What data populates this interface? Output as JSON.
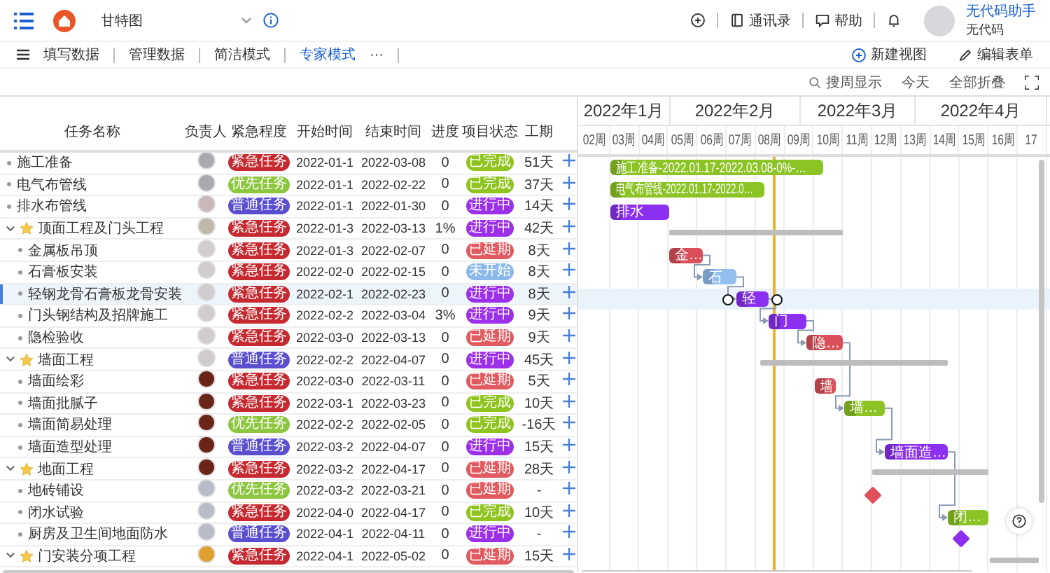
{
  "topbar": {
    "title": "甘特图",
    "actions": [
      {
        "kind": "contacts",
        "label": "通讯录"
      },
      {
        "kind": "help",
        "label": "帮助"
      }
    ],
    "user": {
      "name": "无代码助手",
      "org": "无代码"
    }
  },
  "view_tabs": [
    {
      "label": "填写数据",
      "selected": false
    },
    {
      "label": "管理数据",
      "selected": false
    },
    {
      "label": "简洁模式",
      "selected": false
    },
    {
      "label": "专家模式",
      "selected": true
    }
  ],
  "more": "···",
  "view_actions": [
    {
      "kind": "new",
      "label": "新建视图"
    },
    {
      "kind": "edit",
      "label": "编辑表单"
    }
  ],
  "toolbar": [
    {
      "kind": "search",
      "label": "搜周显示"
    },
    {
      "kind": "plain",
      "label": "今天"
    },
    {
      "kind": "plain",
      "label": "全部折叠"
    }
  ],
  "table": {
    "columns": [
      "任务名称",
      "负责人",
      "紧急程度",
      "开始时间",
      "结束时间",
      "进度",
      "项目状态",
      "工期"
    ],
    "rows": [
      {
        "name": "施工准备",
        "selected": false,
        "owner": {
          "color": "#a8aab0"
        },
        "urgency": {
          "label": "紧急任务",
          "color": "#c62a30"
        },
        "start": "2022-01-1",
        "end": "2022-03-08",
        "progress": "0",
        "status": {
          "label": "已完成",
          "color": "#8fc31f"
        },
        "duration": "51天",
        "bar": {
          "kind": "bar",
          "label": "施工准备-2022.01.17-2022.03.08-0%-…",
          "color": "#8cc425"
        }
      },
      {
        "name": "电气布管线",
        "selected": false,
        "owner": {
          "color": "#a8aab0"
        },
        "urgency": {
          "label": "优先任务",
          "color": "#8dc63f"
        },
        "start": "2022-01-1",
        "end": "2022-02-22",
        "progress": "0",
        "status": {
          "label": "已完成",
          "color": "#8fc31f"
        },
        "duration": "37天",
        "bar": {
          "kind": "bar",
          "label": "电气布管线-2022.01.17-2022.0…",
          "color": "#8cc425"
        }
      },
      {
        "name": "排水布管线",
        "selected": false,
        "owner": {
          "color": "#c8b8b8"
        },
        "urgency": {
          "label": "普通任务",
          "color": "#5a4fcf"
        },
        "start": "2022-01-1",
        "end": "2022-01-30",
        "progress": "0",
        "status": {
          "label": "进行中",
          "color": "#9b30e8"
        },
        "duration": "14天",
        "bar": {
          "kind": "bar",
          "label": "排水",
          "color": "#8b2ff0"
        }
      },
      {
        "name": "顶面工程及门头工程",
        "expanded": true,
        "selected": false,
        "owner": {
          "color": "#c0b8a8"
        },
        "urgency": {
          "label": "紧急任务",
          "color": "#c62a30"
        },
        "start": "2022-01-3",
        "end": "2022-03-13",
        "progress": "1%",
        "status": {
          "label": "进行中",
          "color": "#9b30e8"
        },
        "duration": "42天",
        "bar": {
          "kind": "summary"
        },
        "children": [
          {
            "name": "金属板吊顶",
            "selected": false,
            "owner": {
              "color": "#d0ccd0"
            },
            "urgency": {
              "label": "紧急任务",
              "color": "#c62a30"
            },
            "start": "2022-01-3",
            "end": "2022-02-07",
            "progress": "0",
            "status": {
              "label": "已延期",
              "color": "#e05a5f"
            },
            "duration": "8天",
            "bar": {
              "kind": "bar",
              "label": "金…",
              "color": "#d9505a"
            }
          },
          {
            "name": "石膏板安装",
            "selected": false,
            "owner": {
              "color": "#d0ccd0"
            },
            "urgency": {
              "label": "紧急任务",
              "color": "#c62a30"
            },
            "start": "2022-02-0",
            "end": "2022-02-15",
            "progress": "0",
            "status": {
              "label": "未开始",
              "color": "#8ab8ea"
            },
            "duration": "8天",
            "bar": {
              "kind": "bar",
              "label": "石",
              "color": "#92bfee"
            }
          },
          {
            "name": "轻钢龙骨石膏板龙骨安装",
            "selected": true,
            "owner": {
              "color": "#d0ccd0"
            },
            "urgency": {
              "label": "紧急任务",
              "color": "#c62a30"
            },
            "start": "2022-02-1",
            "end": "2022-02-23",
            "progress": "0",
            "status": {
              "label": "进行中",
              "color": "#9b30e8"
            },
            "duration": "8天",
            "bar": {
              "kind": "bar",
              "label": "轻",
              "color": "#8b2ff0"
            }
          },
          {
            "name": "门头钢结构及招牌施工",
            "selected": false,
            "owner": {
              "color": "#d0ccd0"
            },
            "urgency": {
              "label": "紧急任务",
              "color": "#c62a30"
            },
            "start": "2022-02-2",
            "end": "2022-03-04",
            "progress": "3%",
            "status": {
              "label": "进行中",
              "color": "#9b30e8"
            },
            "duration": "9天",
            "bar": {
              "kind": "bar",
              "label": "门",
              "color": "#8b2ff0"
            }
          },
          {
            "name": "隐检验收",
            "selected": false,
            "owner": {
              "color": "#d0ccd0"
            },
            "urgency": {
              "label": "紧急任务",
              "color": "#c62a30"
            },
            "start": "2022-03-0",
            "end": "2022-03-13",
            "progress": "0",
            "status": {
              "label": "已延期",
              "color": "#e05a5f"
            },
            "duration": "9天",
            "bar": {
              "kind": "bar",
              "label": "隐…",
              "color": "#d9505a"
            }
          }
        ]
      },
      {
        "name": "墙面工程",
        "expanded": true,
        "selected": false,
        "owner": {
          "color": "#d0ccd0"
        },
        "urgency": {
          "label": "普通任务",
          "color": "#5a4fcf"
        },
        "start": "2022-02-2",
        "end": "2022-04-07",
        "progress": "0",
        "status": {
          "label": "进行中",
          "color": "#9b30e8"
        },
        "duration": "45天",
        "bar": {
          "kind": "summary"
        },
        "children": [
          {
            "name": "墙面绘彩",
            "selected": false,
            "owner": {
              "color": "#6b2418"
            },
            "urgency": {
              "label": "紧急任务",
              "color": "#c62a30"
            },
            "start": "2022-03-0",
            "end": "2022-03-11",
            "progress": "0",
            "status": {
              "label": "已延期",
              "color": "#e05a5f"
            },
            "duration": "5天",
            "bar": {
              "kind": "bar",
              "label": "墙",
              "color": "#d9505a"
            }
          },
          {
            "name": "墙面批腻子",
            "selected": false,
            "owner": {
              "color": "#6b2418"
            },
            "urgency": {
              "label": "紧急任务",
              "color": "#c62a30"
            },
            "start": "2022-03-1",
            "end": "2022-03-23",
            "progress": "0",
            "status": {
              "label": "已完成",
              "color": "#8fc31f"
            },
            "duration": "10天",
            "bar": {
              "kind": "bar",
              "label": "墙…",
              "color": "#8cc425"
            }
          },
          {
            "name": "墙面简易处理",
            "selected": false,
            "owner": {
              "color": "#6b2418"
            },
            "urgency": {
              "label": "优先任务",
              "color": "#8dc63f"
            },
            "start": "2022-02-2",
            "end": "2022-02-05",
            "progress": "0",
            "status": {
              "label": "已完成",
              "color": "#8fc31f"
            },
            "duration": "-16天"
          },
          {
            "name": "墙面造型处理",
            "selected": false,
            "owner": {
              "color": "#6b2418"
            },
            "urgency": {
              "label": "普通任务",
              "color": "#5a4fcf"
            },
            "start": "2022-03-2",
            "end": "2022-04-07",
            "progress": "0",
            "status": {
              "label": "进行中",
              "color": "#9b30e8"
            },
            "duration": "15天",
            "bar": {
              "kind": "bar",
              "label": "墙面造…",
              "color": "#8b2ff0"
            }
          }
        ]
      },
      {
        "name": "地面工程",
        "expanded": true,
        "selected": false,
        "owner": {
          "color": "#6b2418"
        },
        "urgency": {
          "label": "紧急任务",
          "color": "#c62a30"
        },
        "start": "2022-03-2",
        "end": "2022-04-17",
        "progress": "0",
        "status": {
          "label": "已延期",
          "color": "#e05a5f"
        },
        "duration": "28天",
        "bar": {
          "kind": "summary"
        },
        "children": [
          {
            "name": "地砖铺设",
            "selected": false,
            "owner": {
              "color": "#b8bcc8"
            },
            "urgency": {
              "label": "优先任务",
              "color": "#8dc63f"
            },
            "start": "2022-03-2",
            "end": "2022-03-21",
            "progress": "0",
            "status": {
              "label": "已延期",
              "color": "#e05a5f"
            },
            "duration": "-",
            "bar": {
              "kind": "milestone",
              "color": "#e0505a"
            }
          },
          {
            "name": "闭水试验",
            "selected": false,
            "owner": {
              "color": "#b8bcc8"
            },
            "urgency": {
              "label": "紧急任务",
              "color": "#c62a30"
            },
            "start": "2022-04-0",
            "end": "2022-04-17",
            "progress": "0",
            "status": {
              "label": "已完成",
              "color": "#8fc31f"
            },
            "duration": "10天",
            "bar": {
              "kind": "bar",
              "label": "闭…",
              "color": "#8cc425"
            }
          },
          {
            "name": "厨房及卫生间地面防水",
            "selected": false,
            "owner": {
              "color": "#b8bcc8"
            },
            "urgency": {
              "label": "普通任务",
              "color": "#5a4fcf"
            },
            "start": "2022-04-1",
            "end": "2022-04-11",
            "progress": "0",
            "status": {
              "label": "进行中",
              "color": "#9b30e8"
            },
            "duration": "-",
            "bar": {
              "kind": "milestone",
              "color": "#8b2ff0"
            }
          }
        ]
      },
      {
        "name": "门安装分项工程",
        "expanded": true,
        "selected": false,
        "owner": {
          "color": "#e0a030"
        },
        "urgency": {
          "label": "紧急任务",
          "color": "#c62a30"
        },
        "start": "2022-04-1",
        "end": "2022-05-02",
        "progress": "0",
        "status": {
          "label": "已延期",
          "color": "#e05a5f"
        },
        "duration": "15天",
        "bar": {
          "kind": "summary"
        }
      }
    ]
  },
  "gantt": {
    "months": [
      "2022年1月",
      "2022年2月",
      "2022年3月",
      "2022年4月"
    ],
    "weeks": [
      "02周",
      "03周",
      "04周",
      "05周",
      "06周",
      "07周",
      "08周",
      "09周",
      "10周",
      "11周",
      "12周",
      "13周",
      "14周",
      "15周",
      "16周",
      "17"
    ]
  }
}
